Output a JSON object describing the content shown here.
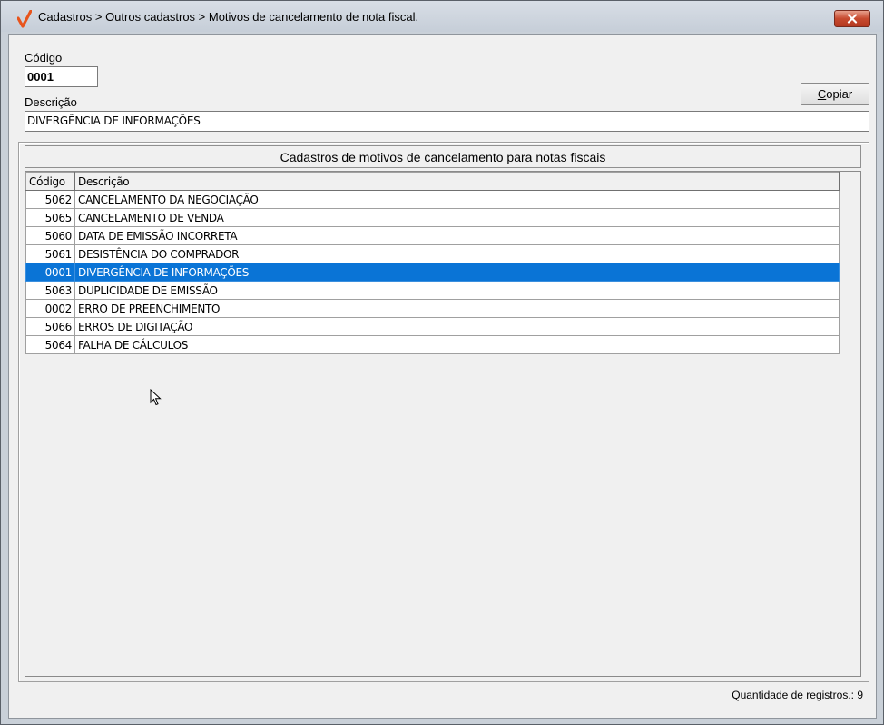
{
  "window": {
    "title": "Cadastros > Outros cadastros > Motivos de cancelamento de nota fiscal.",
    "close_icon": "close-icon",
    "accent_color": "#0a74d6"
  },
  "form": {
    "code_label": "Código",
    "code_value": "0001",
    "description_label": "Descrição",
    "description_value": "DIVERGÊNCIA DE INFORMAÇÕES",
    "copy_button_prefix": "",
    "copy_button_underlined": "C",
    "copy_button_rest": "opiar"
  },
  "grid": {
    "title": "Cadastros de motivos de cancelamento para notas fiscais",
    "columns": [
      "Código",
      "Descrição"
    ],
    "rows": [
      {
        "code": "5062",
        "description": "CANCELAMENTO DA NEGOCIAÇÃO",
        "selected": false
      },
      {
        "code": "5065",
        "description": "CANCELAMENTO DE VENDA",
        "selected": false
      },
      {
        "code": "5060",
        "description": "DATA DE EMISSÃO INCORRETA",
        "selected": false
      },
      {
        "code": "5061",
        "description": "DESISTÊNCIA DO COMPRADOR",
        "selected": false
      },
      {
        "code": "0001",
        "description": "DIVERGÊNCIA DE INFORMAÇÕES",
        "selected": true
      },
      {
        "code": "5063",
        "description": "DUPLICIDADE DE EMISSÃO",
        "selected": false
      },
      {
        "code": "0002",
        "description": "ERRO DE PREENCHIMENTO",
        "selected": false
      },
      {
        "code": "5066",
        "description": "ERROS DE DIGITAÇÃO",
        "selected": false
      },
      {
        "code": "5064",
        "description": "FALHA DE CÁLCULOS",
        "selected": false
      }
    ]
  },
  "status": {
    "record_count_label": "Quantidade de registros.: 9"
  }
}
